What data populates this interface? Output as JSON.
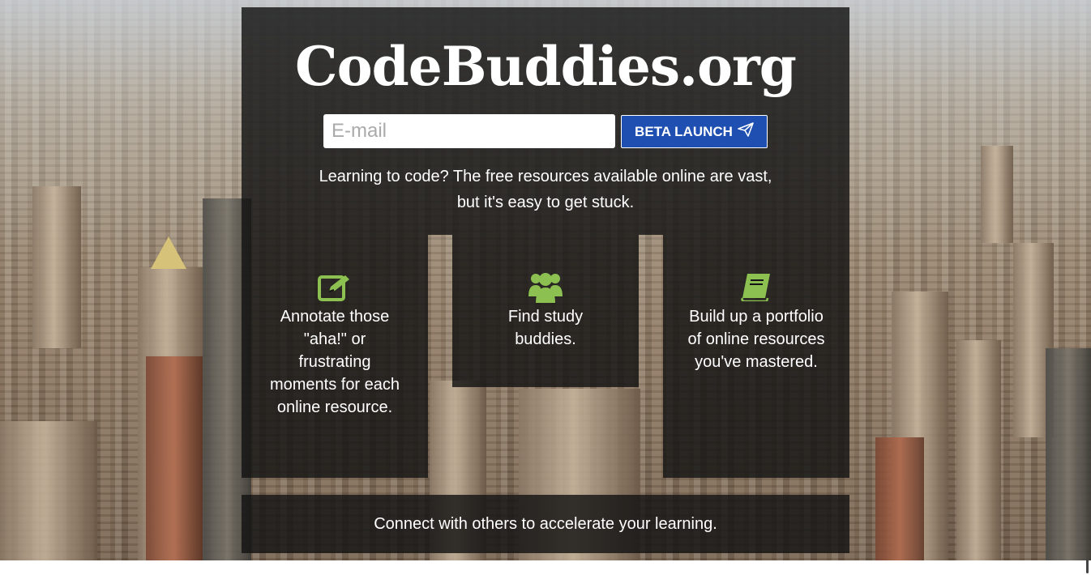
{
  "brand": {
    "logo_text": "CodeBuddies.org"
  },
  "signup": {
    "email_placeholder": "E-mail",
    "button_label": "BETA LAUNCH",
    "button_icon": "paper-plane-icon"
  },
  "intro": {
    "line1": "Learning to code? The free resources available online are vast,",
    "line2": "but it's easy to get stuck."
  },
  "features": [
    {
      "icon": "pencil-square-icon",
      "text": "Annotate those \"aha!\" or frustrating moments for each online resource."
    },
    {
      "icon": "users-icon",
      "text": "Find study buddies."
    },
    {
      "icon": "book-icon",
      "text": "Build up a portfolio of online resources you've mastered."
    }
  ],
  "footer": {
    "text": "Connect with others to accelerate your learning."
  },
  "colors": {
    "accent_green": "#8cc152",
    "button_blue": "#1f4fb0",
    "panel": "#141414"
  }
}
